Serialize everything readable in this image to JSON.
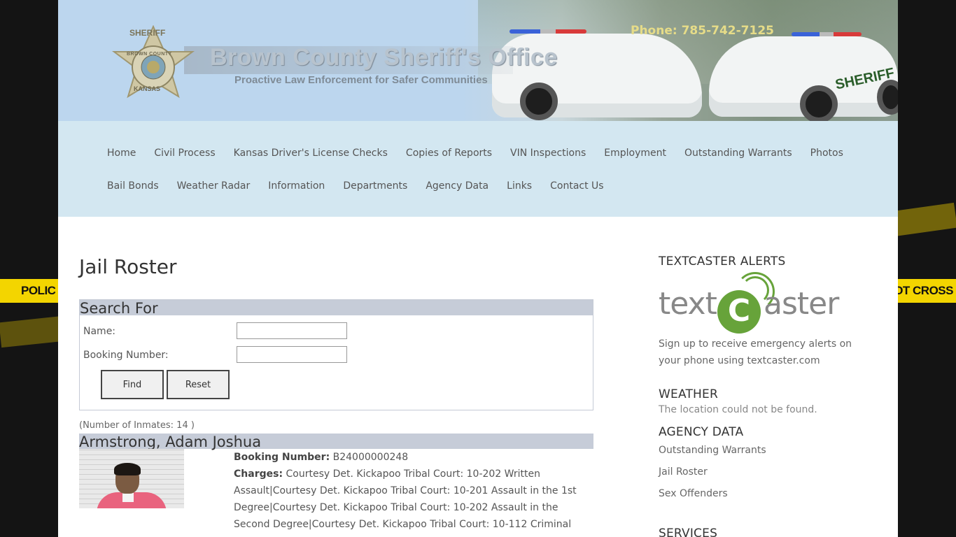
{
  "header": {
    "site_title": "Brown County Sheriff's Office",
    "site_subtitle": "Proactive Law Enforcement for Safer Communities",
    "phone": "Phone: 785-742-7125",
    "badge_top": "SHERIFF",
    "badge_county": "BROWN COUNTY",
    "badge_state": "KANSAS",
    "car_text": "SHERIFF"
  },
  "tape": {
    "left": "POLIC",
    "right": "OT CROSS"
  },
  "nav": {
    "row1": [
      "Home",
      "Civil Process",
      "Kansas Driver's License Checks",
      "Copies of Reports",
      "VIN Inspections",
      "Employment",
      "Outstanding Warrants",
      "Photos"
    ],
    "row2": [
      "Bail Bonds",
      "Weather Radar",
      "Information",
      "Departments",
      "Agency Data",
      "Links",
      "Contact Us"
    ]
  },
  "main": {
    "page_title": "Jail Roster",
    "search": {
      "heading": "Search For",
      "name_label": "Name:",
      "name_value": "",
      "booking_label": "Booking Number:",
      "booking_value": "",
      "find_label": "Find",
      "reset_label": "Reset"
    },
    "inmate_count": "(Number of Inmates: 14 )",
    "inmate": {
      "name": "Armstrong, Adam Joshua",
      "booking_label": "Booking Number:",
      "booking_number": "B24000000248",
      "charges_label": "Charges:",
      "charges": "Courtesy Det. Kickapoo Tribal Court: 10-202 Written Assault|Courtesy Det. Kickapoo Tribal Court: 10-201 Assault in the 1st Degree|Courtesy Det. Kickapoo Tribal Court: 10-202 Assault in the Second Degree|Courtesy Det. Kickapoo Tribal Court: 10-112 Criminal"
    }
  },
  "sidebar": {
    "textcaster_heading": "TEXTCASTER ALERTS",
    "textcaster_logo_left": "text",
    "textcaster_logo_c": "C",
    "textcaster_logo_right": "aster",
    "textcaster_text": "Sign up to receive emergency alerts on your phone using textcaster.com",
    "weather_heading": "WEATHER",
    "weather_text": "The location could not be found.",
    "agency_heading": "AGENCY DATA",
    "agency_links": [
      "Outstanding Warrants",
      "Jail Roster",
      "Sex Offenders"
    ],
    "services_heading": "SERVICES"
  },
  "colors": {
    "accent_nav_bg": "#d3e7f1",
    "tape_yellow": "#f3d500",
    "textcaster_green": "#67a33a"
  }
}
